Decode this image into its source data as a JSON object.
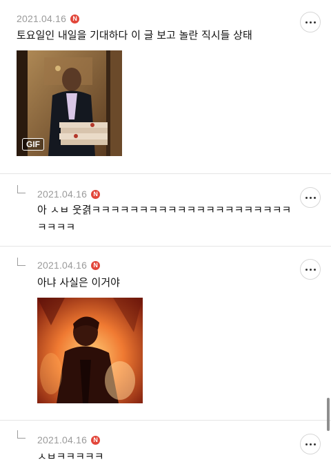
{
  "comments": [
    {
      "date": "2021.04.16",
      "badge": "N",
      "text": "토요일인 내일을 기대하다 이 글 보고 놀란 직시들 상태",
      "media": {
        "type": "gif",
        "label": "GIF",
        "icon": "man-holding-pizza-boxes-image"
      }
    },
    {
      "date": "2021.04.16",
      "badge": "N",
      "text": "아 ㅅㅂ 웃겱ㅋㅋㅋㅋㅋㅋㅋㅋㅋㅋㅋㅋㅋㅋㅋㅋㅋㅋㅋㅋㅋㅋㅋㅋㅋ"
    },
    {
      "date": "2021.04.16",
      "badge": "N",
      "text": "아냐 사실은 이거야",
      "media": {
        "type": "image",
        "icon": "man-in-flames-image"
      }
    },
    {
      "date": "2021.04.16",
      "badge": "N",
      "text": "ㅅㅂㅋㅋㅋㅋㅋ"
    }
  ],
  "colors": {
    "badge": "#e2463a",
    "date": "#9a9a9a",
    "divider": "#e4e4e4"
  }
}
